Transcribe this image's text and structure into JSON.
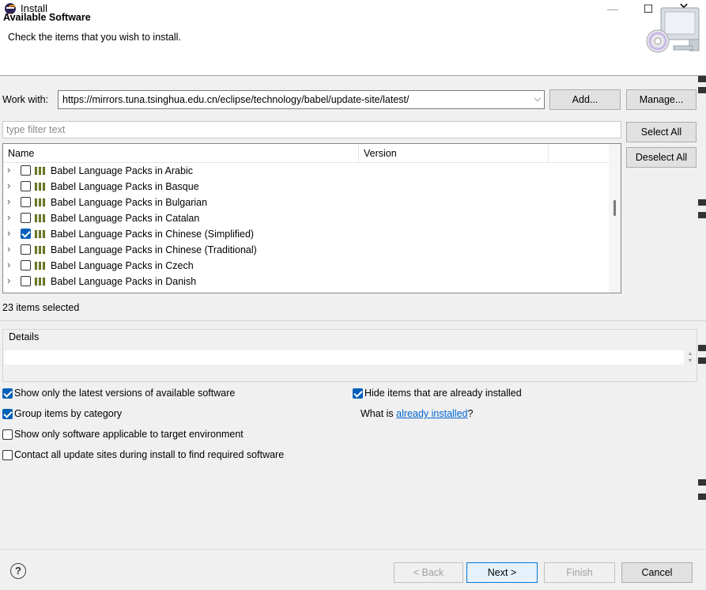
{
  "window": {
    "title": "Install",
    "minimize": "—",
    "maximize": "☐",
    "close": "✕"
  },
  "banner": {
    "title": "Available Software",
    "subtitle": "Check the items that you wish to install."
  },
  "work_with": {
    "label": "Work with:",
    "value": "https://mirrors.tuna.tsinghua.edu.cn/eclipse/technology/babel/update-site/latest/",
    "add_label": "Add...",
    "manage_label": "Manage..."
  },
  "filter": {
    "placeholder": "type filter text"
  },
  "buttons": {
    "select_all": "Select All",
    "deselect_all": "Deselect All"
  },
  "tree": {
    "columns": {
      "name": "Name",
      "version": "Version"
    },
    "rows": [
      {
        "label": "Babel Language Packs in Arabic",
        "checked": false
      },
      {
        "label": "Babel Language Packs in Basque",
        "checked": false
      },
      {
        "label": "Babel Language Packs in Bulgarian",
        "checked": false
      },
      {
        "label": "Babel Language Packs in Catalan",
        "checked": false
      },
      {
        "label": "Babel Language Packs in Chinese (Simplified)",
        "checked": true
      },
      {
        "label": "Babel Language Packs in Chinese (Traditional)",
        "checked": false
      },
      {
        "label": "Babel Language Packs in Czech",
        "checked": false
      },
      {
        "label": "Babel Language Packs in Danish",
        "checked": false
      }
    ]
  },
  "status": {
    "selected_count": "23 items selected"
  },
  "details": {
    "label": "Details"
  },
  "options": {
    "latest_versions": {
      "label": "Show only the latest versions of available software",
      "checked": true
    },
    "group_by_category": {
      "label": "Group items by category",
      "checked": true
    },
    "target_env": {
      "label": "Show only software applicable to target environment",
      "checked": false
    },
    "contact_sites": {
      "label": "Contact all update sites during install to find required software",
      "checked": false
    },
    "hide_installed": {
      "label": "Hide items that are already installed",
      "checked": true
    },
    "what_is_prefix": "What is ",
    "already_installed_link": "already installed",
    "what_is_suffix": "?"
  },
  "footer": {
    "help": "?",
    "back": "< Back",
    "next": "Next >",
    "finish": "Finish",
    "cancel": "Cancel"
  },
  "colors": {
    "accent": "#005fb8",
    "link": "#0066cc",
    "focus_border": "#0078d7"
  }
}
